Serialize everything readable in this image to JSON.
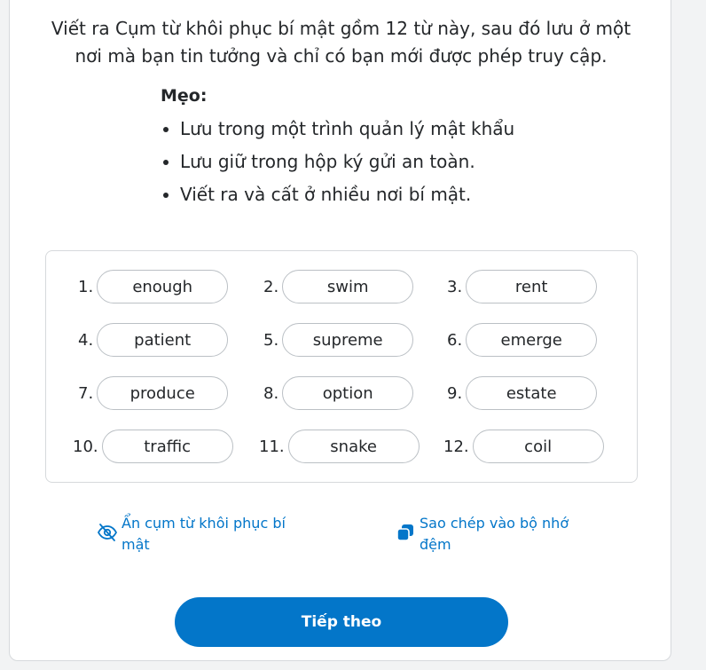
{
  "intro": {
    "line1": "Viết ra Cụm từ khôi phục bí mật gồm 12 từ này, sau đó lưu ở một",
    "line2": "nơi mà bạn tin tưởng và chỉ có bạn mới được phép truy cập."
  },
  "tips": {
    "title": "Mẹo:",
    "items": [
      "Lưu trong một trình quản lý mật khẩu",
      "Lưu giữ trong hộp ký gửi an toàn.",
      "Viết ra và cất ở nhiều nơi bí mật."
    ]
  },
  "phrase": [
    {
      "num": "1.",
      "word": "enough"
    },
    {
      "num": "2.",
      "word": "swim"
    },
    {
      "num": "3.",
      "word": "rent"
    },
    {
      "num": "4.",
      "word": "patient"
    },
    {
      "num": "5.",
      "word": "supreme"
    },
    {
      "num": "6.",
      "word": "emerge"
    },
    {
      "num": "7.",
      "word": "produce"
    },
    {
      "num": "8.",
      "word": "option"
    },
    {
      "num": "9.",
      "word": "estate"
    },
    {
      "num": "10.",
      "word": "traffic"
    },
    {
      "num": "11.",
      "word": "snake"
    },
    {
      "num": "12.",
      "word": "coil"
    }
  ],
  "actions": {
    "hide": {
      "line1": "Ẩn cụm từ khôi phục bí",
      "line2": "mật",
      "icon": "eye-slash-icon"
    },
    "copy": {
      "line1": "Sao chép vào bộ nhớ",
      "line2": "đệm",
      "icon": "copy-icon"
    }
  },
  "next_button": "Tiếp theo",
  "colors": {
    "accent": "#0376c9",
    "text": "#24272a",
    "border": "#bbc0c5"
  }
}
